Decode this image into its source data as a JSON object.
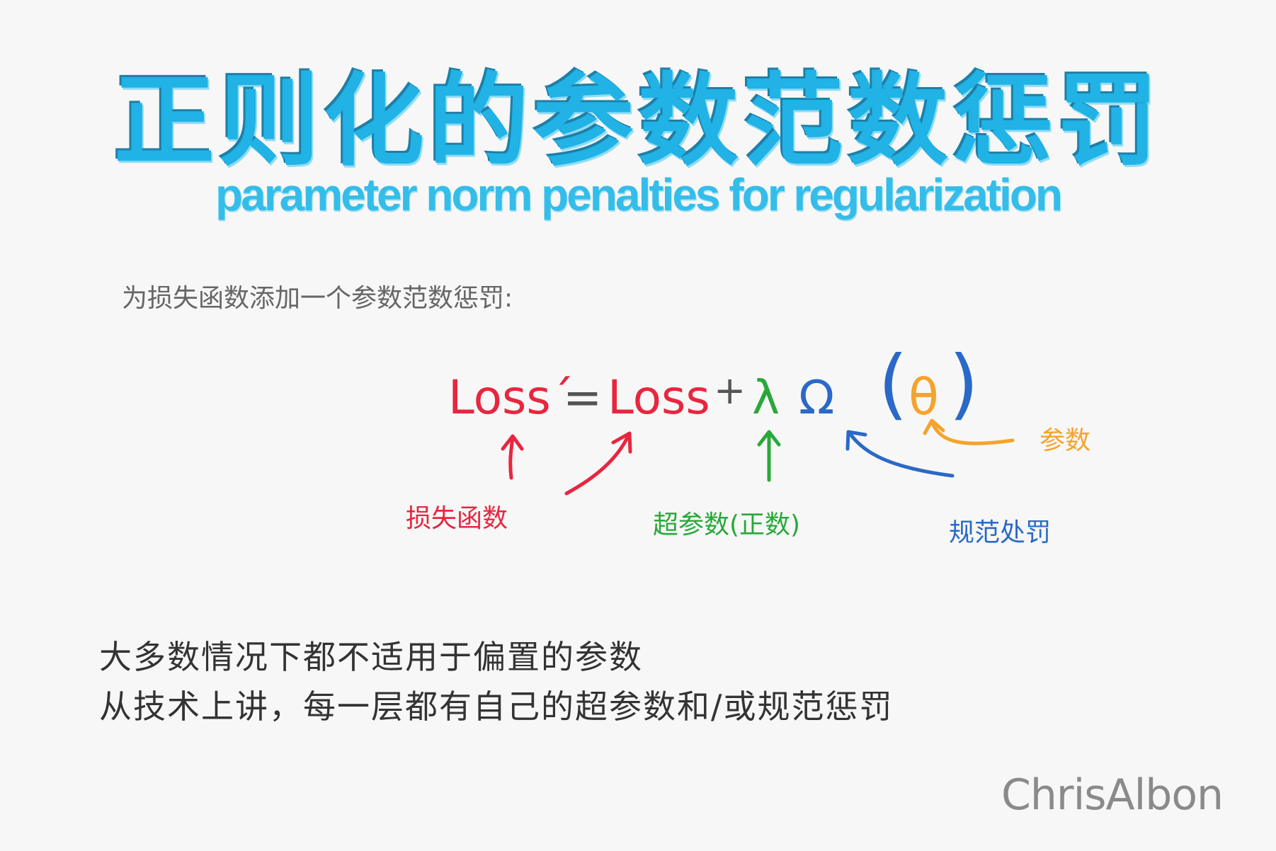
{
  "title": {
    "zh": "正则化的参数范数惩罚",
    "en": "parameter norm penalties for regularization"
  },
  "intro": "为损失函数添加一个参数范数惩罚:",
  "equation": {
    "loss_prime": "Loss´",
    "equals": "=",
    "loss": "Loss",
    "plus": "+",
    "lambda": "λ",
    "omega": "Ω",
    "paren_open": "(",
    "theta": "θ",
    "paren_close": ")"
  },
  "labels": {
    "loss_function": "损失函数",
    "hyperparameter": "超参数(正数)",
    "norm_penalty": "规范处罚",
    "parameters": "参数"
  },
  "notes": [
    "大多数情况下都不适用于偏置的参数",
    "从技术上讲，每一层都有自己的超参数和/或规范惩罚"
  ],
  "signature": "ChrisAlbon",
  "colors": {
    "title": "#21b2e6",
    "loss": "#e8263f",
    "hyper": "#29a83a",
    "norm": "#2a69c7",
    "param": "#f5a32c",
    "text": "#333333"
  }
}
